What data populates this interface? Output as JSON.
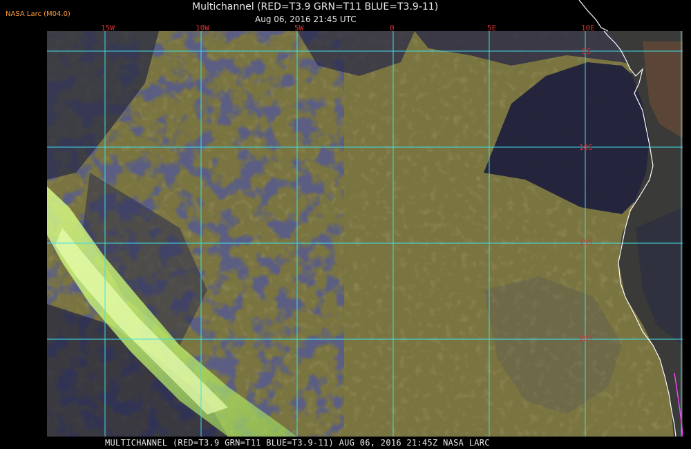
{
  "header": {
    "brand": "NASA Larc (M04.0)",
    "title": "Multichannel (RED=T3.9 GRN=T11 BLUE=T3.9-11)",
    "datetime": "Aug 06, 2016 21:45 UTC"
  },
  "footer": {
    "caption": "MULTICHANNEL (RED=T3.9 GRN=T11 BLUE=T3.9-11) AUG 06, 2016 21:45Z   NASA LARC"
  },
  "map": {
    "longitude_labels": [
      "15W",
      "10W",
      "5W",
      "0",
      "5E",
      "10E"
    ],
    "latitude_labels": [
      "5S",
      "10S",
      "15S",
      "20S"
    ],
    "colors": {
      "grid": "#3fe0e8",
      "label": "#d83232",
      "coastline": "#ffffff",
      "border": "#ff40ff",
      "ocean_cloud": "#7a7440",
      "clear_ocean": "#1c1e3c",
      "high_cloud": "#d8ff8a"
    }
  }
}
